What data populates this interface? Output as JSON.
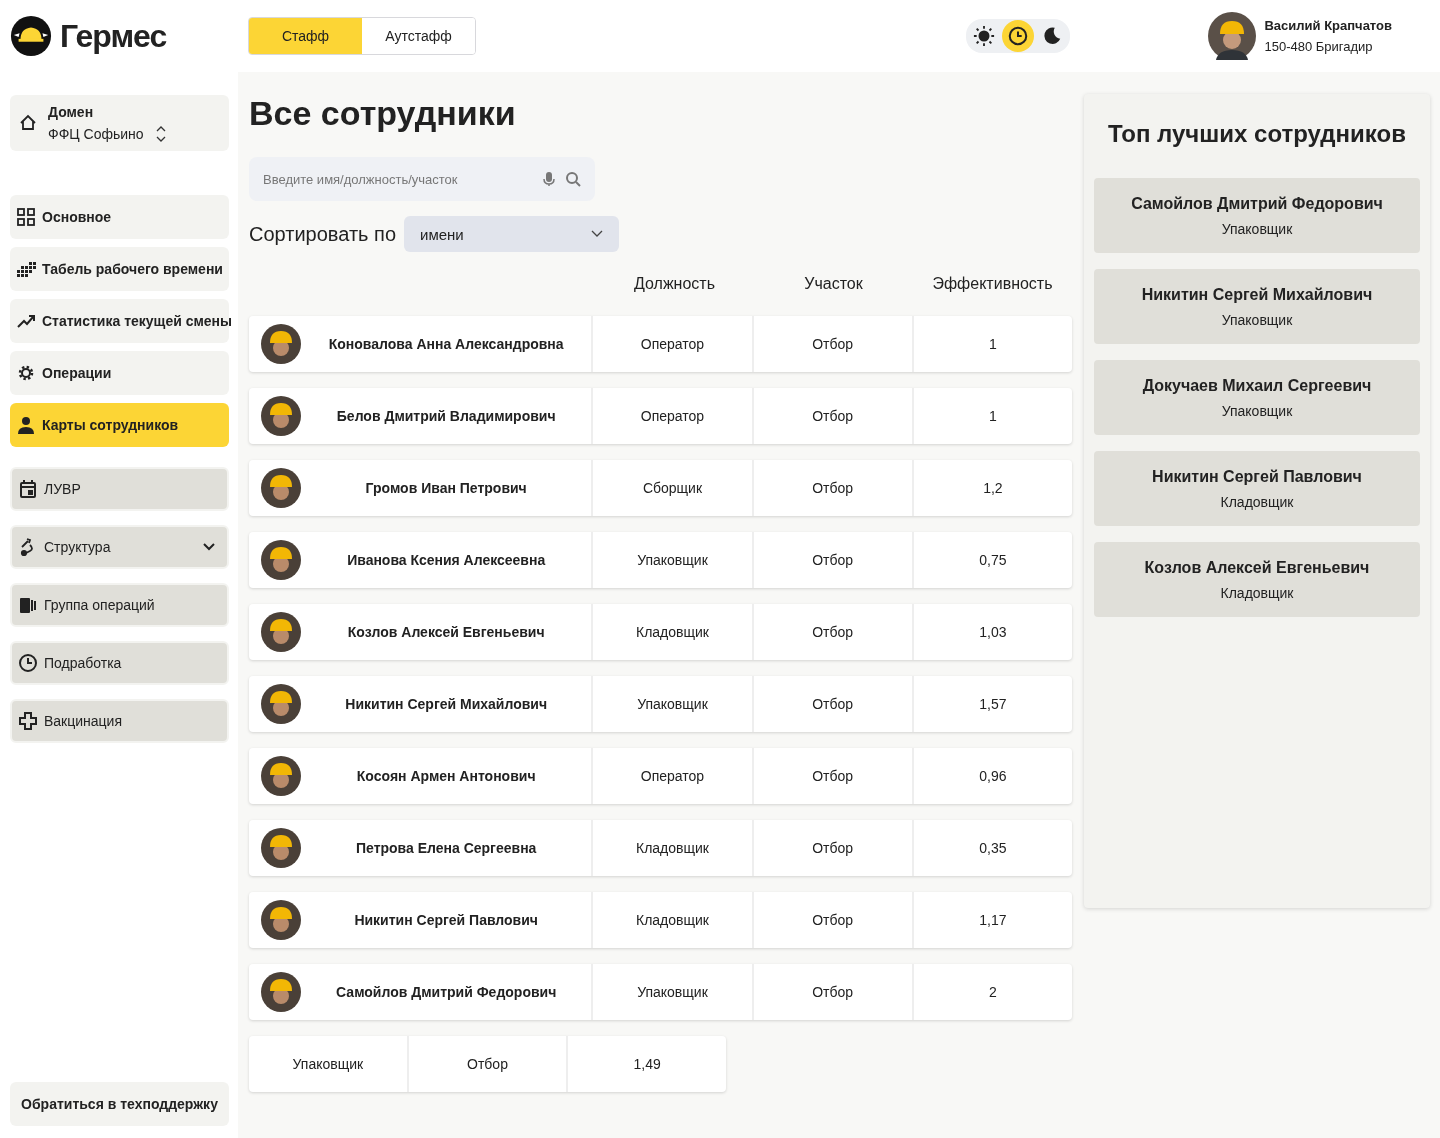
{
  "logo": {
    "text": "Гермес"
  },
  "tabs": [
    {
      "label": "Стафф",
      "selected": true
    },
    {
      "label": "Аутстафф",
      "selected": false
    }
  ],
  "theme_switch": [
    {
      "selected": false
    },
    {
      "selected": true
    },
    {
      "selected": false
    }
  ],
  "user": {
    "name": "Василий Крапчатов",
    "subtitle": "150-480 Бригадир"
  },
  "domain": {
    "label": "Домен",
    "value": "ФФЦ Софьино"
  },
  "sidebar": {
    "items": [
      {
        "label": "Основное",
        "kind": "primary",
        "selected": false
      },
      {
        "label": "Табель рабочего времени",
        "kind": "primary",
        "selected": false
      },
      {
        "label": "Статистика текущей смены",
        "kind": "primary",
        "selected": false
      },
      {
        "label": "Операции",
        "kind": "primary",
        "selected": false
      },
      {
        "label": "Карты сотрудников",
        "kind": "primary",
        "selected": true
      },
      {
        "label": "ЛУВР",
        "kind": "secondary",
        "selected": false
      },
      {
        "label": "Структура",
        "kind": "secondary",
        "selected": false,
        "expandable": true
      },
      {
        "label": "Группа операций",
        "kind": "secondary",
        "selected": false
      },
      {
        "label": "Подработка",
        "kind": "secondary",
        "selected": false
      },
      {
        "label": "Вакцинация",
        "kind": "secondary",
        "selected": false
      }
    ],
    "support": "Обратиться в техподдержку"
  },
  "page_title": "Все сотрудники",
  "search": {
    "placeholder": "Введите имя/должность/участок"
  },
  "sort": {
    "label": "Сортировать по",
    "value": "имени"
  },
  "table": {
    "columns": [
      "Должность",
      "Участок",
      "Эффективность"
    ],
    "rows": [
      {
        "name": "Коновалова Анна Александровна",
        "position": "Оператор",
        "area": "Отбор",
        "efficiency": "1"
      },
      {
        "name": "Белов Дмитрий Владимирович",
        "position": "Оператор",
        "area": "Отбор",
        "efficiency": "1"
      },
      {
        "name": "Громов Иван Петрович",
        "position": "Сборщик",
        "area": "Отбор",
        "efficiency": "1,2"
      },
      {
        "name": "Иванова Ксения Алексеевна",
        "position": "Упаковщик",
        "area": "Отбор",
        "efficiency": "0,75"
      },
      {
        "name": "Козлов Алексей Евгеньевич",
        "position": "Кладовщик",
        "area": "Отбор",
        "efficiency": "1,03"
      },
      {
        "name": "Никитин Сергей Михайлович",
        "position": "Упаковщик",
        "area": "Отбор",
        "efficiency": "1,57"
      },
      {
        "name": "Косоян Армен Антонович",
        "position": "Оператор",
        "area": "Отбор",
        "efficiency": "0,96"
      },
      {
        "name": "Петрова Елена Сергеевна",
        "position": "Кладовщик",
        "area": "Отбор",
        "efficiency": "0,35"
      },
      {
        "name": "Никитин Сергей Павлович",
        "position": "Кладовщик",
        "area": "Отбор",
        "efficiency": "1,17"
      },
      {
        "name": "Самойлов Дмитрий Федорович",
        "position": "Упаковщик",
        "area": "Отбор",
        "efficiency": "2"
      }
    ],
    "partial_row": {
      "position": "Упаковщик",
      "area": "Отбор",
      "efficiency": "1,49"
    }
  },
  "top_panel": {
    "title": "Топ лучших сотрудников",
    "items": [
      {
        "name": "Самойлов Дмитрий Федорович",
        "role": "Упаковщик"
      },
      {
        "name": "Никитин Сергей Михайлович",
        "role": "Упаковщик"
      },
      {
        "name": "Докучаев Михаил Сергеевич",
        "role": "Упаковщик"
      },
      {
        "name": "Никитин Сергей Павлович",
        "role": "Кладовщик"
      },
      {
        "name": "Козлов Алексей Евгеньевич",
        "role": "Кладовщик"
      }
    ]
  }
}
